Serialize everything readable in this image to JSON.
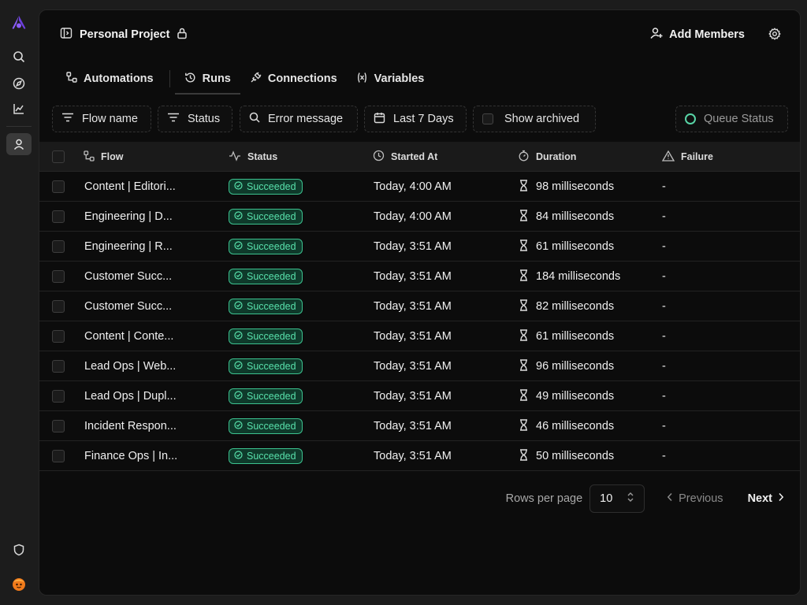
{
  "project": {
    "name": "Personal Project"
  },
  "header": {
    "add_members_label": "Add Members"
  },
  "tabs": [
    {
      "label": "Automations",
      "icon": "flow-icon"
    },
    {
      "label": "Runs",
      "icon": "history-icon"
    },
    {
      "label": "Connections",
      "icon": "plug-icon"
    },
    {
      "label": "Variables",
      "icon": "variable-icon"
    }
  ],
  "filters": {
    "flow_name": "Flow name",
    "status": "Status",
    "error_message": "Error message",
    "date_range": "Last 7 Days",
    "show_archived": "Show archived",
    "queue_status": "Queue Status"
  },
  "table": {
    "columns": {
      "flow": "Flow",
      "status": "Status",
      "started_at": "Started At",
      "duration": "Duration",
      "failure": "Failure"
    },
    "rows": [
      {
        "flow": "Content | Editori...",
        "status": "Succeeded",
        "started": "Today, 4:00 AM",
        "duration": "98 milliseconds",
        "failure": "-"
      },
      {
        "flow": "Engineering | D...",
        "status": "Succeeded",
        "started": "Today, 4:00 AM",
        "duration": "84 milliseconds",
        "failure": "-"
      },
      {
        "flow": "Engineering | R...",
        "status": "Succeeded",
        "started": "Today, 3:51 AM",
        "duration": "61 milliseconds",
        "failure": "-"
      },
      {
        "flow": "Customer Succ...",
        "status": "Succeeded",
        "started": "Today, 3:51 AM",
        "duration": "184 milliseconds",
        "failure": "-"
      },
      {
        "flow": "Customer Succ...",
        "status": "Succeeded",
        "started": "Today, 3:51 AM",
        "duration": "82 milliseconds",
        "failure": "-"
      },
      {
        "flow": "Content | Conte...",
        "status": "Succeeded",
        "started": "Today, 3:51 AM",
        "duration": "61 milliseconds",
        "failure": "-"
      },
      {
        "flow": "Lead Ops | Web...",
        "status": "Succeeded",
        "started": "Today, 3:51 AM",
        "duration": "96 milliseconds",
        "failure": "-"
      },
      {
        "flow": "Lead Ops | Dupl...",
        "status": "Succeeded",
        "started": "Today, 3:51 AM",
        "duration": "49 milliseconds",
        "failure": "-"
      },
      {
        "flow": "Incident Respon...",
        "status": "Succeeded",
        "started": "Today, 3:51 AM",
        "duration": "46 milliseconds",
        "failure": "-"
      },
      {
        "flow": "Finance Ops | In...",
        "status": "Succeeded",
        "started": "Today, 3:51 AM",
        "duration": "50 milliseconds",
        "failure": "-"
      }
    ]
  },
  "pagination": {
    "rows_per_page_label": "Rows per page",
    "rows_per_page": "10",
    "previous": "Previous",
    "next": "Next"
  },
  "colors": {
    "accent": "#7c4dff",
    "success": "#3cc28f",
    "success_bg": "#0f3a2b"
  }
}
